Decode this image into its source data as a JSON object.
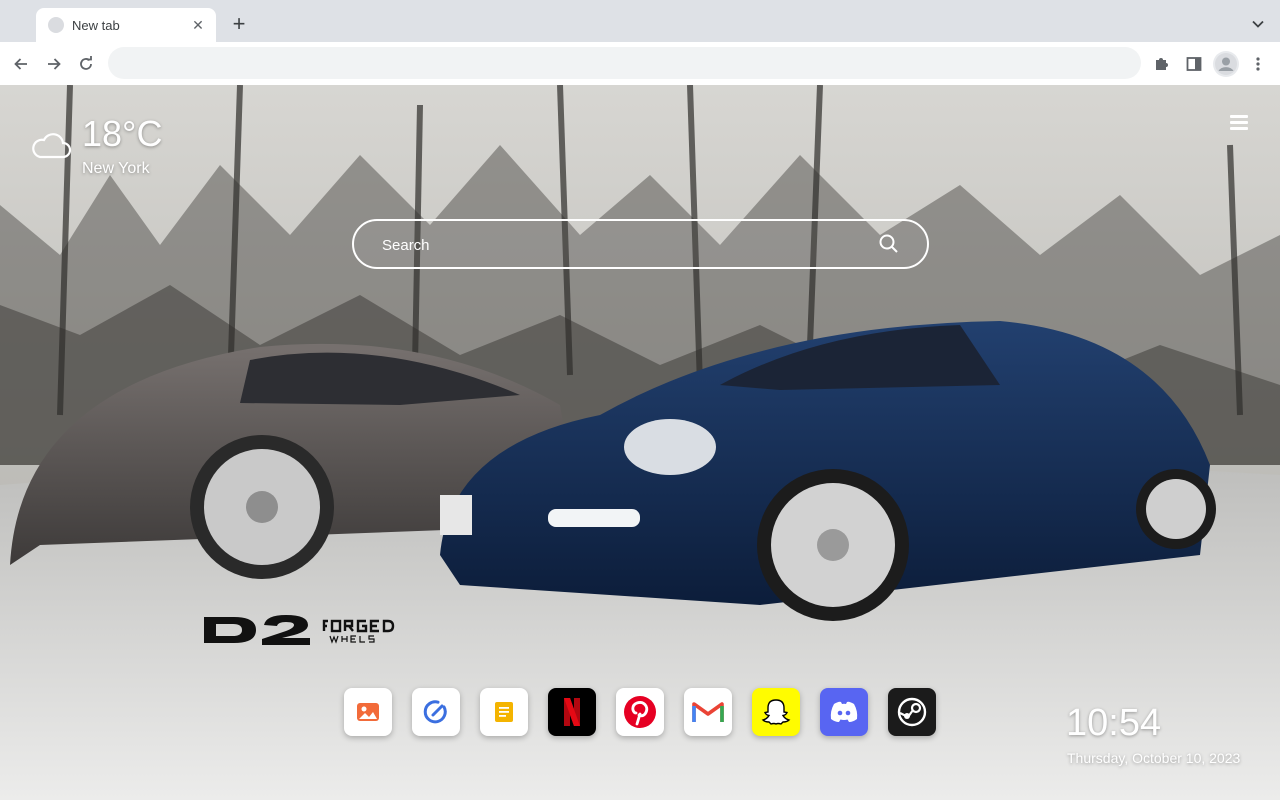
{
  "tabs": [
    {
      "title": "New tab",
      "icon": "blank-favicon-icon",
      "close_icon": "close-icon",
      "active": true
    }
  ],
  "tabstrip": {
    "new_tab_symbol": "+",
    "new_tab_icon": "plus-icon",
    "search_tabs_icon": "chevron-down-icon"
  },
  "toolbar": {
    "back_icon": "arrow-left-icon",
    "forward_icon": "arrow-right-icon",
    "reload_icon": "reload-icon",
    "address_value": "",
    "extensions_icon": "puzzle-icon",
    "side_panel_icon": "side-panel-icon",
    "profile_icon": "avatar-icon",
    "menu_icon": "kebab-menu-icon"
  },
  "weather": {
    "icon": "cloud-icon",
    "temperature": "18°C",
    "city": "New York"
  },
  "menu": {
    "icon": "hamburger-icon"
  },
  "search": {
    "placeholder": "Search",
    "icon": "search-icon"
  },
  "logo": {
    "brand": "D2",
    "line1": "FORGED",
    "line2": "WHEELS"
  },
  "dock": {
    "apps": [
      {
        "name": "Photos",
        "icon": "image-icon",
        "bg": "#ffffff",
        "accent": "#f26b3a"
      },
      {
        "name": "Speed",
        "icon": "gauge-icon",
        "bg": "#ffffff",
        "accent": "#3b6fe0"
      },
      {
        "name": "Notes",
        "icon": "notes-icon",
        "bg": "#ffffff",
        "accent": "#f4b400"
      },
      {
        "name": "Netflix",
        "icon": "netflix-icon",
        "bg": "#000000",
        "accent": "#e50914"
      },
      {
        "name": "Pinterest",
        "icon": "pinterest-icon",
        "bg": "#ffffff",
        "accent": "#e60023"
      },
      {
        "name": "Gmail",
        "icon": "gmail-icon",
        "bg": "#ffffff",
        "accent": "#ea4335"
      },
      {
        "name": "Snapchat",
        "icon": "snapchat-icon",
        "bg": "#fffc00",
        "accent": "#000000"
      },
      {
        "name": "Discord",
        "icon": "discord-icon",
        "bg": "#5865f2",
        "accent": "#ffffff"
      },
      {
        "name": "Steam",
        "icon": "steam-icon",
        "bg": "#1b1b1b",
        "accent": "#ffffff"
      }
    ]
  },
  "clock": {
    "time": "10:54",
    "date": "Thursday, October 10, 2023"
  }
}
